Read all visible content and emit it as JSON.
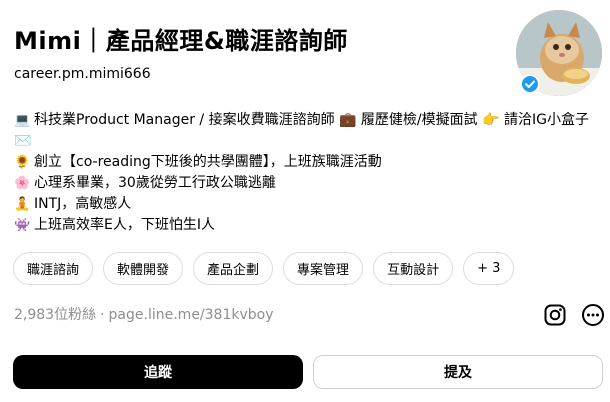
{
  "profile": {
    "name": "Mimi｜產品經理&職涯諮詢師",
    "handle": "career.pm.mimi666",
    "verified_icon": "verified-badge-icon"
  },
  "bio": [
    {
      "icon": "💻",
      "text": "科技業Product Manager / 接案收費職涯諮詢師 💼 履歷健檢/模擬面試 👉 請洽IG小盒子 ✉️"
    },
    {
      "icon": "🌻",
      "text": "創立【co-reading下班後的共學團體】，上班族職涯活動"
    },
    {
      "icon": "🌸",
      "text": "心理系畢業，30歲從勞工行政公職逃離"
    },
    {
      "icon": "🧘",
      "text": "INTJ，高敏感人"
    },
    {
      "icon": "👾",
      "text": "上班高效率E人，下班怕生I人"
    }
  ],
  "tags": [
    "職涯諮詢",
    "軟體開發",
    "產品企劃",
    "專案管理",
    "互動設計",
    "+ 3"
  ],
  "stats": {
    "followers": "2,983位粉絲",
    "separator": "·",
    "link": "page.line.me/381kvboy"
  },
  "actions": {
    "follow": "追蹤",
    "mention": "提及"
  },
  "colors": {
    "verified": "#1d9bf0",
    "muted": "#8e8e8e",
    "follow_bg": "#000000"
  }
}
